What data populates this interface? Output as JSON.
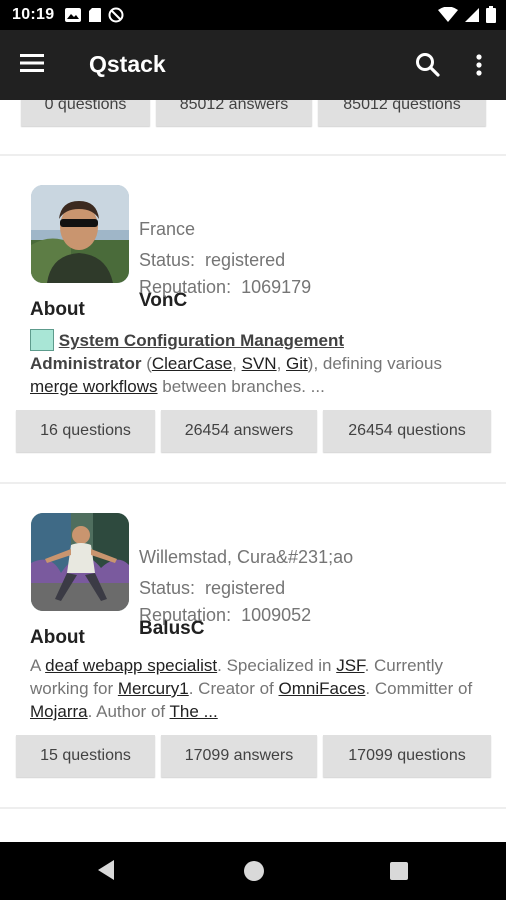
{
  "status_bar": {
    "time": "10:19",
    "left_icons": [
      "image-icon",
      "sd-card-icon",
      "no-disturb-icon"
    ],
    "right_icons": [
      "wifi-icon",
      "signal-icon",
      "battery-icon"
    ]
  },
  "app_bar": {
    "title": "Qstack",
    "background": "#212121"
  },
  "top_stats": [
    "0 questions",
    "85012 answers",
    "85012 questions"
  ],
  "users": [
    {
      "name": "VonC",
      "location": "France",
      "status_label": "Status:",
      "status": "registered",
      "reputation_label": "Reputation:",
      "reputation": "1069179",
      "about_title": "About",
      "about": {
        "t1": "System Configuration Management",
        "t2": "Administrator",
        "t3": " (",
        "l1": "ClearCase",
        "t4": ", ",
        "l2": "SVN",
        "t5": ", ",
        "l3": "Git",
        "t6": "), defining various ",
        "l4": "merge workflows",
        "t7": " between branches. ..."
      },
      "stats": [
        "16 questions",
        "26454 answers",
        "26454 questions"
      ]
    },
    {
      "name": "BalusC",
      "location": "Willemstad, Cura&#231;ao",
      "status_label": "Status:",
      "status": "registered",
      "reputation_label": "Reputation:",
      "reputation": "1009052",
      "about_title": "About",
      "about": {
        "t1": "A ",
        "l1": "deaf webapp specialist",
        "t2": ". Specialized in ",
        "l2": "JSF",
        "t3": ". Currently working for ",
        "l3": "Mercury1",
        "t4": ". Creator of ",
        "l4": "OmniFaces",
        "t5": ". Committer of ",
        "l5": "Mojarra",
        "t6": ". Author of ",
        "l6": "The ..."
      },
      "stats": [
        "15 questions",
        "17099 answers",
        "17099 questions"
      ]
    }
  ]
}
